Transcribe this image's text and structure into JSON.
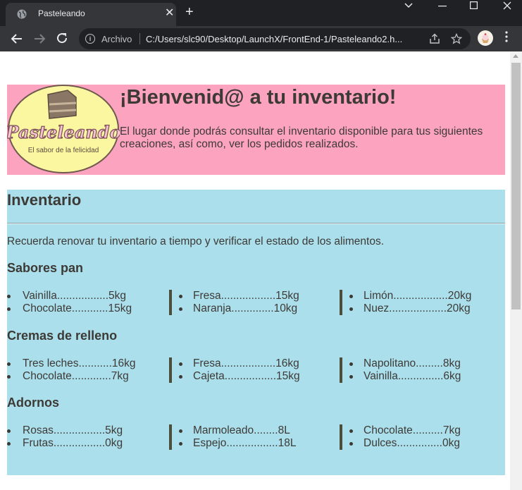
{
  "browser": {
    "tab_title": "Pasteleando",
    "tab_close": "✕",
    "new_tab": "+",
    "omnibox_label": "Archivo",
    "url": "C:/Users/slc90/Desktop/LaunchX/FrontEnd-1/Pasteleando2.h..."
  },
  "header": {
    "logo_text": "Pasteleando",
    "logo_slogan": "El sabor de la felicidad",
    "title": "¡Bienvenid@ a tu inventario!",
    "description": "El lugar donde podrás consultar el inventario disponible para tus siguientes creaciones, así como, ver los pedidos realizados."
  },
  "inventory": {
    "title": "Inventario",
    "note": "Recuerda renovar tu inventario a tiempo y verificar el estado de los alimentos.",
    "categories": [
      {
        "title": "Sabores pan",
        "columns": [
          [
            "Vainilla.................5kg",
            "Chocolate............15kg"
          ],
          [
            "Fresa..................15kg",
            "Naranja..............10kg"
          ],
          [
            "Limón..................20kg",
            "Nuez...................20kg"
          ]
        ]
      },
      {
        "title": "Cremas de relleno",
        "columns": [
          [
            "Tres leches...........16kg",
            "Chocolate.............7kg"
          ],
          [
            "Fresa..................16kg",
            "Cajeta.................15kg"
          ],
          [
            "Napolitano.........8kg",
            "Vainilla...............6kg"
          ]
        ]
      },
      {
        "title": "Adornos",
        "columns": [
          [
            "Rosas.................5kg",
            "Frutas.................0kg"
          ],
          [
            "Marmoleado........8L",
            "Espejo.................18L"
          ],
          [
            "Chocolate..........7kg",
            "Dulces...............0kg"
          ]
        ]
      }
    ]
  }
}
